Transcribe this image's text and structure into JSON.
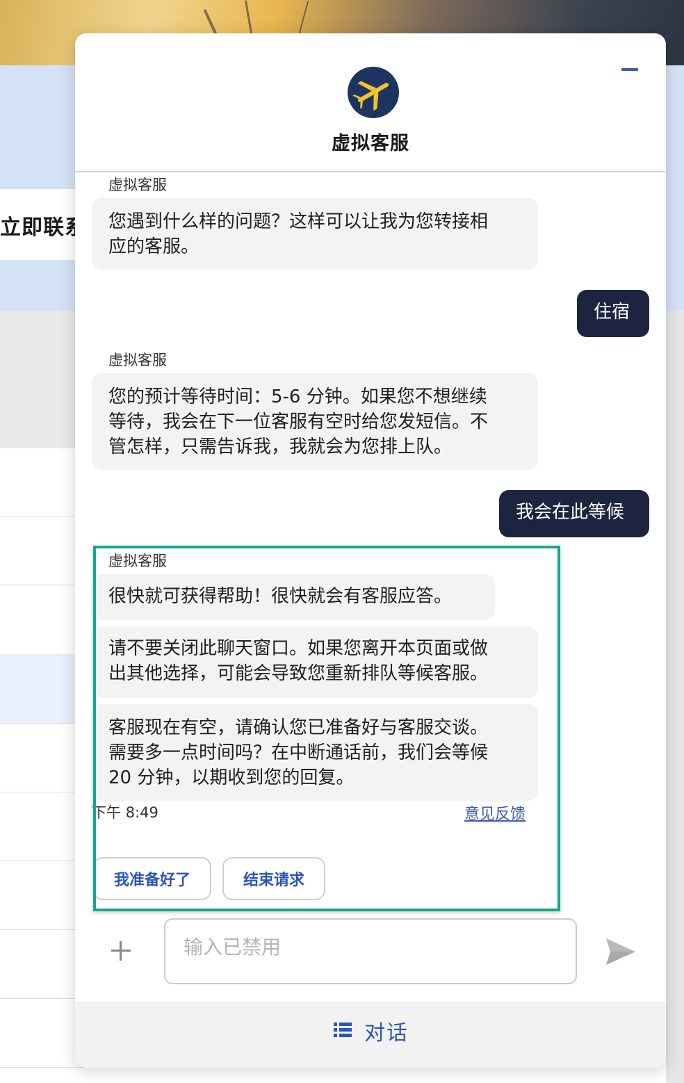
{
  "background": {
    "contact_heading": "立即联系"
  },
  "chat": {
    "title": "虚拟客服",
    "header_logo": "airplane-logo",
    "messages": [
      {
        "role": "agent",
        "sender": "虚拟客服",
        "lines": [
          "您遇到什么样的问题？这样可以让我为您转接相",
          "应的客服。"
        ]
      },
      {
        "role": "user",
        "text": "住宿"
      },
      {
        "role": "agent",
        "sender": "虚拟客服",
        "lines": [
          "您的预计等待时间：5-6 分钟。如果您不想继续",
          "等待，我会在下一位客服有空时给您发短信。不",
          "管怎样，只需告诉我，我就会为您排上队。"
        ]
      },
      {
        "role": "user",
        "text": "我会在此等候"
      },
      {
        "role": "agent",
        "sender": "虚拟客服",
        "bubbles": [
          {
            "lines": [
              "很快就可获得帮助！很快就会有客服应答。"
            ]
          },
          {
            "lines": [
              "请不要关闭此聊天窗口。如果您离开本页面或做",
              "出其他选择，可能会导致您重新排队等候客服。"
            ]
          },
          {
            "lines": [
              "客服现在有空，请确认您已准备好与客服交谈。",
              "需要多一点时间吗？在中断通话前，我们会等候",
              "20 分钟，以期收到您的回复。"
            ]
          }
        ]
      }
    ],
    "timestamp": "下午 8:49",
    "feedback_link": "意见反馈",
    "quick_replies": [
      "我准备好了",
      "结束请求"
    ],
    "input_placeholder": "输入已禁用",
    "footer_tab": "对话",
    "colors": {
      "accent": "#2c55b9",
      "user_bubble": "#1d2440",
      "agent_bubble": "#f3f3f3",
      "highlight": "#17a88b",
      "logo_bg": "#1d3360",
      "logo_plane": "#f2c230"
    }
  }
}
